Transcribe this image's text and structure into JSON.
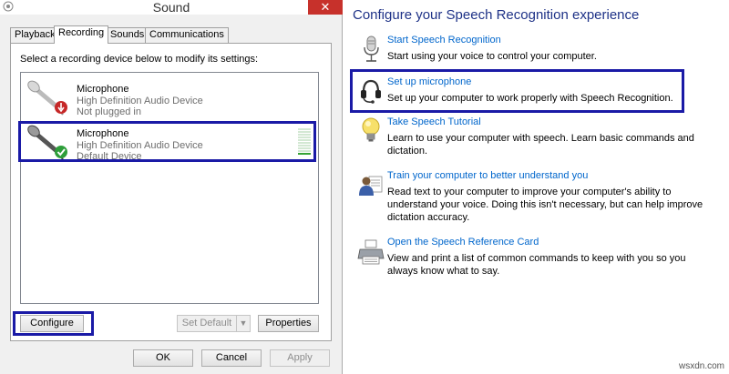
{
  "window": {
    "title": "Sound",
    "close_glyph": "✕",
    "system_icon": "speaker-icon"
  },
  "tabs": [
    {
      "label": "Playback",
      "active": false
    },
    {
      "label": "Recording",
      "active": true
    },
    {
      "label": "Sounds",
      "active": false
    },
    {
      "label": "Communications",
      "active": false
    }
  ],
  "recording": {
    "instruction": "Select a recording device below to modify its settings:",
    "devices": [
      {
        "name": "Microphone",
        "driver": "High Definition Audio Device",
        "status": "Not plugged in",
        "status_icon": "unplugged-icon",
        "selected": false
      },
      {
        "name": "Microphone",
        "driver": "High Definition Audio Device",
        "status": "Default Device",
        "status_icon": "default-check-icon",
        "selected": true,
        "level_fraction": 0.1
      }
    ]
  },
  "buttons": {
    "configure": "Configure",
    "set_default": "Set Default",
    "properties": "Properties",
    "ok": "OK",
    "cancel": "Cancel",
    "apply": "Apply"
  },
  "speech": {
    "title": "Configure your Speech Recognition experience",
    "items": [
      {
        "link": "Start Speech Recognition",
        "desc": "Start using your voice to control your computer.",
        "icon": "microphone-icon"
      },
      {
        "link": "Set up microphone",
        "desc": "Set up your computer to work properly with Speech Recognition.",
        "icon": "headset-icon"
      },
      {
        "link": "Take Speech Tutorial",
        "desc": "Learn to use your computer with speech.  Learn basic commands and dictation.",
        "icon": "lightbulb-icon"
      },
      {
        "link": "Train your computer to better understand you",
        "desc": "Read text to your computer to improve your computer's ability to understand your voice. Doing this isn't necessary, but can help improve dictation accuracy.",
        "icon": "train-user-icon"
      },
      {
        "link": "Open the Speech Reference Card",
        "desc": "View and print a list of common commands to keep with you so you always know what to say.",
        "icon": "printer-icon"
      }
    ]
  },
  "watermark": "wsxdn.com",
  "colors": {
    "highlight_box": "#1a1aa6",
    "link": "#0066cc",
    "heading": "#1e3287",
    "close_button": "#c7312b",
    "level_meter": "#36a336"
  }
}
